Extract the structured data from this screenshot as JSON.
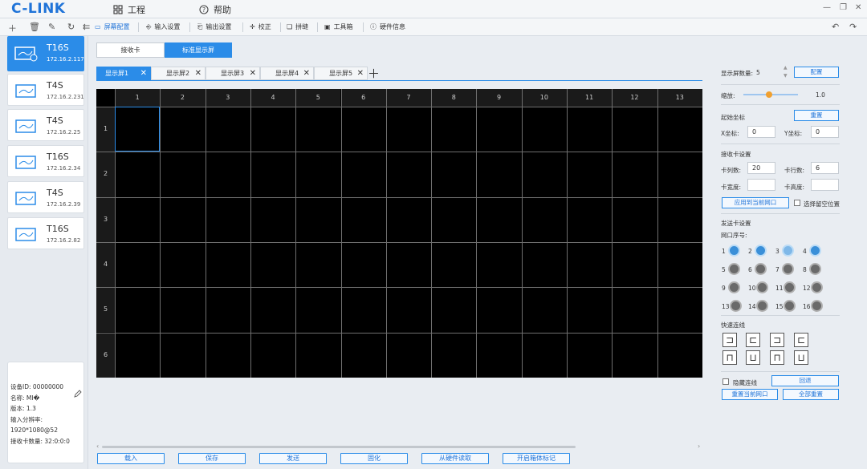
{
  "app": {
    "logo": "C-LINK"
  },
  "topmenu": {
    "project": "工程",
    "help": "帮助"
  },
  "toolbar": {
    "items": [
      {
        "label": "屏幕配置"
      },
      {
        "label": "输入设置"
      },
      {
        "label": "输出设置"
      },
      {
        "label": "校正"
      },
      {
        "label": "拼缝"
      },
      {
        "label": "工具箱"
      },
      {
        "label": "硬件信息"
      }
    ]
  },
  "devices": [
    {
      "name": "T16S",
      "ip": "172.16.2.117"
    },
    {
      "name": "T4S",
      "ip": "172.16.2.231"
    },
    {
      "name": "T4S",
      "ip": "172.16.2.25"
    },
    {
      "name": "T16S",
      "ip": "172.16.2.34"
    },
    {
      "name": "T4S",
      "ip": "172.16.2.39"
    },
    {
      "name": "T16S",
      "ip": "172.16.2.82"
    }
  ],
  "device_info": {
    "device_id": "设备ID: 00000000",
    "name_label": "名称:",
    "name_value": "MI�",
    "version": "版本: 1.3",
    "resolution_label": "输入分辨率:",
    "resolution_value": "1920*1080@52",
    "card_count": "接收卡数量:  32:0:0:0"
  },
  "card_tabs": {
    "receive": "接收卡",
    "standard": "标准显示屏"
  },
  "screen_tabs": [
    "显示屏1",
    "显示屏2",
    "显示屏3",
    "显示屏4",
    "显示屏5"
  ],
  "grid": {
    "columns": [
      "1",
      "2",
      "3",
      "4",
      "5",
      "6",
      "7",
      "8",
      "9",
      "10",
      "11",
      "12",
      "13"
    ],
    "rows": [
      "1",
      "2",
      "3",
      "4",
      "5",
      "6"
    ]
  },
  "bottom_buttons": {
    "load": "载入",
    "save": "保存",
    "send": "发送",
    "solidify": "固化",
    "read_hw": "从硬件读取",
    "grid_mark": "开启箱体标记"
  },
  "right": {
    "screen_count_label": "显示屏数量:",
    "screen_count_value": "5",
    "config_btn": "配置",
    "zoom_label": "缩放:",
    "zoom_value": "1.0",
    "start_coord_label": "起始坐标",
    "reset_btn": "重置",
    "x_label": "X坐标:",
    "x_value": "0",
    "y_label": "Y坐标:",
    "y_value": "0",
    "rc_settings_label": "接收卡设置",
    "cols_label": "卡列数:",
    "cols_value": "20",
    "rows_label": "卡行数:",
    "rows_value": "6",
    "width_label": "卡宽度:",
    "height_label": "卡高度:",
    "apply_port_btn": "应用到当前网口",
    "select_empty_label": "选择留空位置",
    "send_settings_label": "发送卡设置",
    "port_seq_label": "网口序号:",
    "ports": [
      "1",
      "2",
      "3",
      "4",
      "5",
      "6",
      "7",
      "8",
      "9",
      "10",
      "11",
      "12",
      "13",
      "14",
      "15",
      "16"
    ],
    "quick_connect_label": "快速连线",
    "hide_lines_label": "隐藏连线",
    "undo_btn": "回退",
    "reset_port_btn": "重置当前网口",
    "reset_all_btn": "全部重置"
  },
  "colors": {
    "accent": "#2b8ce8",
    "port_active": "#3a8fd8",
    "port_inactive": "#6a6a6a"
  }
}
